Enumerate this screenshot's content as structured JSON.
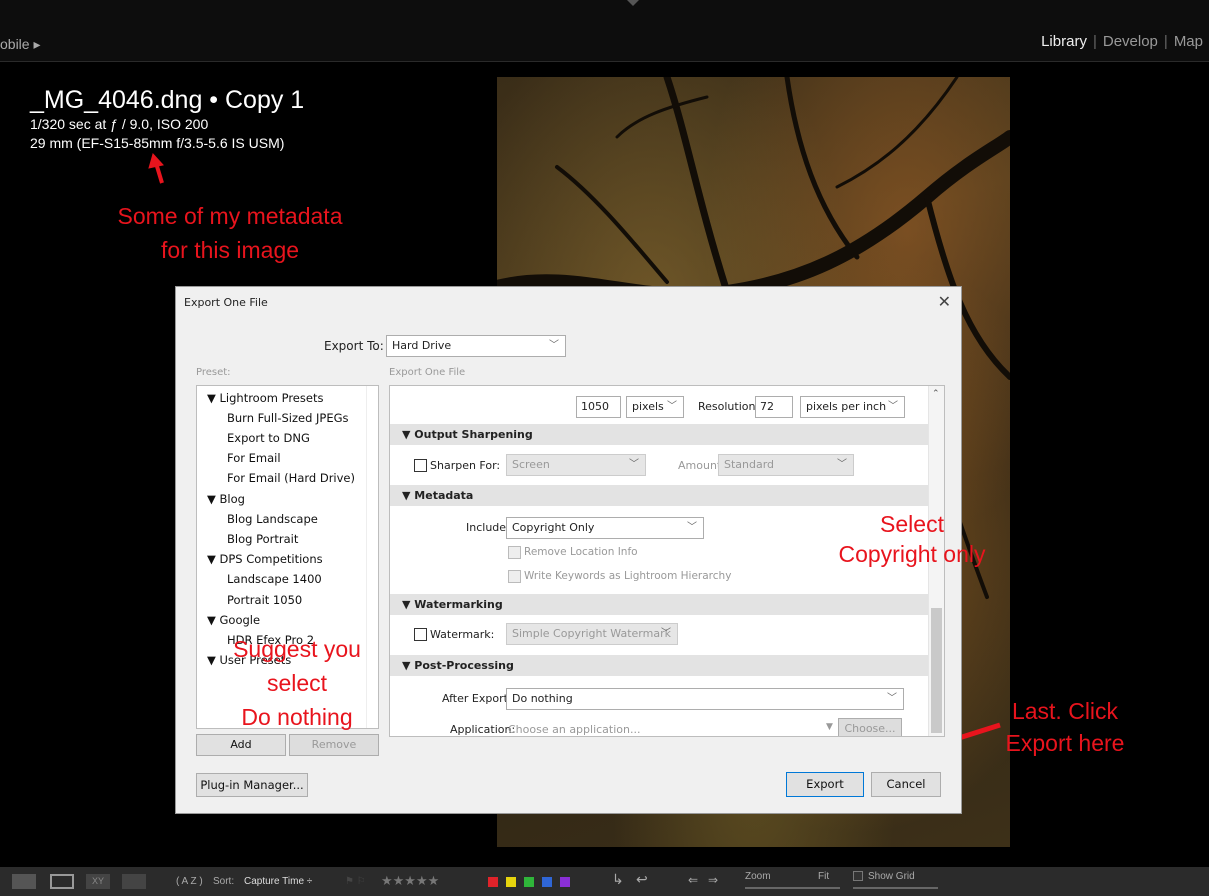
{
  "topbar": {
    "mobile_label": "obile ▸",
    "modules": [
      "Library",
      "Develop",
      "Map"
    ]
  },
  "overlay_info": {
    "filename": "_MG_4046.dng • Copy 1",
    "exposure": "1/320 sec at ƒ / 9.0, ISO 200",
    "lens": "29 mm (EF-S15-85mm f/3.5-5.6 IS USM)"
  },
  "annotations": {
    "metadata_note_1": "Some of my metadata",
    "metadata_note_2": "for this image",
    "select_1": "Select",
    "select_2": "Copyright only",
    "suggest_1": "Suggest you",
    "suggest_2": "select",
    "suggest_3": "Do nothing",
    "last_1": "Last. Click",
    "last_2": "Export here",
    "color": "#e8141d"
  },
  "dialog": {
    "title": "Export One File",
    "export_to_label": "Export To:",
    "export_to_value": "Hard Drive",
    "preset_label": "Preset:",
    "settings_label": "Export One File",
    "presets": [
      {
        "label": "▼ Lightroom Presets",
        "level": 0
      },
      {
        "label": "Burn Full-Sized JPEGs",
        "level": 1
      },
      {
        "label": "Export to DNG",
        "level": 1
      },
      {
        "label": "For Email",
        "level": 1
      },
      {
        "label": "For Email (Hard Drive)",
        "level": 1
      },
      {
        "label": "▼ Blog",
        "level": 0
      },
      {
        "label": "Blog Landscape",
        "level": 1
      },
      {
        "label": "Blog Portrait",
        "level": 1
      },
      {
        "label": "▼ DPS Competitions",
        "level": 0
      },
      {
        "label": "Landscape 1400",
        "level": 1
      },
      {
        "label": "Portrait 1050",
        "level": 1
      },
      {
        "label": "▼ Google",
        "level": 0
      },
      {
        "label": "HDR Efex Pro 2",
        "level": 1
      },
      {
        "label": "▼ User Presets",
        "level": 0
      }
    ],
    "add_button": "Add",
    "remove_button": "Remove",
    "plugin_manager_button": "Plug-in Manager...",
    "export_button": "Export",
    "cancel_button": "Cancel",
    "sizing": {
      "size_value": "1050",
      "size_unit": "pixels",
      "resolution_label": "Resolution:",
      "resolution_value": "72",
      "resolution_unit": "pixels per inch"
    },
    "output_sharpening": {
      "header": "▼ Output Sharpening",
      "sharpen_for_label": "Sharpen For:",
      "sharpen_for_value": "Screen",
      "amount_label": "Amount:",
      "amount_value": "Standard"
    },
    "metadata": {
      "header": "▼ Metadata",
      "include_label": "Include:",
      "include_value": "Copyright Only",
      "remove_location": "Remove Location Info",
      "write_keywords": "Write Keywords as Lightroom Hierarchy"
    },
    "watermarking": {
      "header": "▼ Watermarking",
      "watermark_label": "Watermark:",
      "watermark_value": "Simple Copyright Watermark"
    },
    "post_processing": {
      "header": "▼ Post-Processing",
      "after_export_label": "After Export:",
      "after_export_value": "Do nothing",
      "application_label": "Application:",
      "application_placeholder": "Choose an application...",
      "choose_button": "Choose..."
    }
  },
  "filmstrip": {
    "sort_label": "Sort:",
    "sort_value": "Capture Time ÷",
    "stars": "★★★★★",
    "zoom_label": "Zoom",
    "fit_label": "Fit",
    "show_grid_label": "Show Grid",
    "color_labels": [
      "#e0232a",
      "#e6d40e",
      "#2fb53a",
      "#2f66d6",
      "#8a2fd6"
    ]
  }
}
